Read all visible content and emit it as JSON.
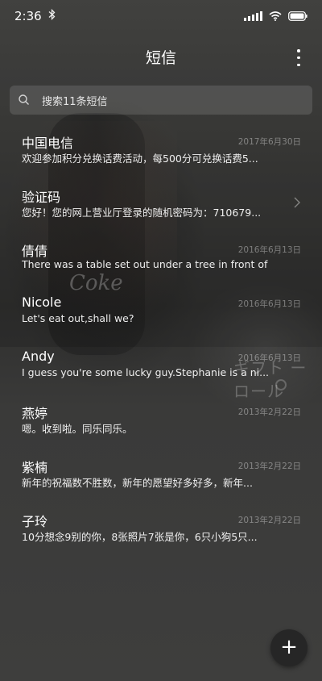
{
  "status": {
    "time": "2:36",
    "bluetooth": "bluetooth-icon"
  },
  "header": {
    "title": "短信"
  },
  "search": {
    "placeholder": "搜索11条短信"
  },
  "conversations": [
    {
      "name": "中国电信",
      "date": "2017年6月30日",
      "preview": "欢迎参加积分兑换话费活动，每500分可兑换话费5..."
    },
    {
      "name": "验证码",
      "date": "",
      "preview": "您好！您的网上营业厅登录的随机密码为：710679..."
    },
    {
      "name": "倩倩",
      "date": "2016年6月13日",
      "preview": "There was a table set out under a tree in front of ..."
    },
    {
      "name": "Nicole",
      "date": "2016年6月13日",
      "preview": "Let's eat out,shall we?"
    },
    {
      "name": "Andy",
      "date": "2016年6月13日",
      "preview": "I guess you're some lucky guy.Stephanie is a ni..."
    },
    {
      "name": "燕婷",
      "date": "2013年2月22日",
      "preview": "嗯。收到啦。同乐同乐。"
    },
    {
      "name": "紫楠",
      "date": "2013年2月22日",
      "preview": "新年的祝福数不胜数，新年的愿望好多好多，新年..."
    },
    {
      "name": "子玲",
      "date": "2013年2月22日",
      "preview": "10分想念9别的你，8张照片7张是你，6只小狗5只..."
    }
  ],
  "background_text": {
    "logo": "Coke",
    "katakana": "ギフト ーロール"
  },
  "fab": {
    "label": "+"
  }
}
